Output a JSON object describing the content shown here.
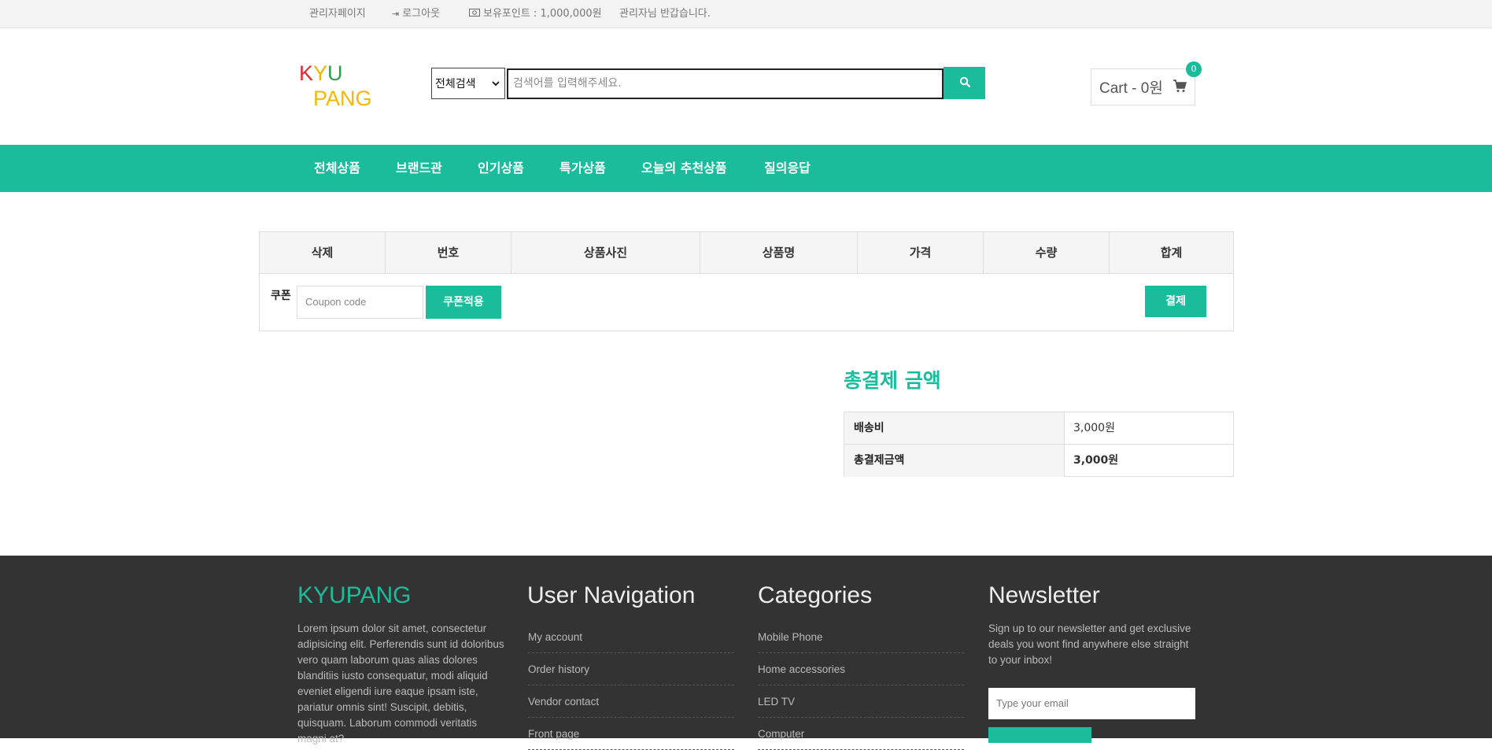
{
  "topbar": {
    "admin_page": "관리자페이지",
    "logout": "로그아웃",
    "points": "보유포인트 : 1,000,000원",
    "greeting": "관리자님 반갑습니다."
  },
  "logo": {
    "line1": [
      "K",
      "Y",
      "U"
    ],
    "line2": "PANG",
    "colors": {
      "K": "#e8262b",
      "Y": "#f0b400",
      "U": "#2e9e4a",
      "PANG": "#f5b800"
    }
  },
  "search": {
    "category": "전체검색",
    "placeholder": "검색어를 입력해주세요."
  },
  "cart": {
    "label": "Cart - 0원",
    "count": "0"
  },
  "nav": [
    "전체상품",
    "브랜드관",
    "인기상품",
    "특가상품",
    "오늘의 추천상품",
    "질의응답"
  ],
  "table": {
    "headers": [
      "삭제",
      "번호",
      "상품사진",
      "상품명",
      "가격",
      "수량",
      "합계"
    ],
    "coupon_label": "쿠폰",
    "coupon_placeholder": "Coupon code",
    "apply_coupon": "쿠폰적용",
    "checkout": "결제"
  },
  "totals": {
    "title": "총결제 금액",
    "rows": [
      {
        "label": "배송비",
        "value": "3,000원"
      },
      {
        "label": "총결제금액",
        "value": "3,000원"
      }
    ]
  },
  "footer": {
    "brand": "KYUPANG",
    "brand_text": [
      "Lorem ipsum dolor sit amet, consectetur",
      "adipisicing elit. Perferendis sunt id doloribus",
      "vero quam laborum quas alias dolores",
      "blanditiis iusto consequatur, modi aliquid",
      "eveniet eligendi iure eaque ipsam iste,",
      "pariatur omnis sint! Suscipit, debitis,",
      "quisquam. Laborum commodi veritatis",
      "magni at?"
    ],
    "user_nav_title": "User Navigation",
    "user_nav": [
      "My account",
      "Order history",
      "Vendor contact",
      "Front page"
    ],
    "categories_title": "Categories",
    "categories": [
      "Mobile Phone",
      "Home accessories",
      "LED TV",
      "Computer"
    ],
    "newsletter_title": "Newsletter",
    "newsletter_text": [
      "Sign up to our newsletter and get exclusive",
      "deals you wont find anywhere else straight",
      "to your inbox!"
    ],
    "newsletter_placeholder": "Type your email"
  },
  "colors": {
    "accent": "#1abc9c",
    "footer_bg": "#333333",
    "topbar_bg": "#f3f3f3"
  }
}
